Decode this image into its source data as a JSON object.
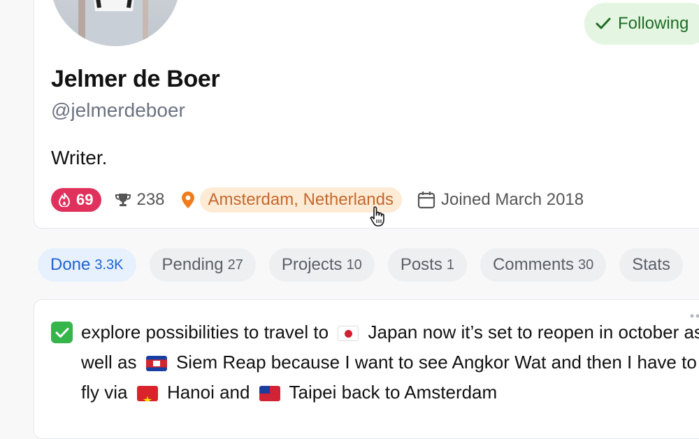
{
  "profile": {
    "name": "Jelmer de Boer",
    "handle": "@jelmerdeboer",
    "bio": "Writer.",
    "follow_label": "Following",
    "streak": "69",
    "praise": "238",
    "location": "Amsterdam, Netherlands",
    "joined": "Joined March 2018"
  },
  "tabs": [
    {
      "label": "Done",
      "count": "3.3K",
      "active": true
    },
    {
      "label": "Pending",
      "count": "27",
      "active": false
    },
    {
      "label": "Projects",
      "count": "10",
      "active": false
    },
    {
      "label": "Posts",
      "count": "1",
      "active": false
    },
    {
      "label": "Comments",
      "count": "30",
      "active": false
    },
    {
      "label": "Stats",
      "count": "",
      "active": false
    }
  ],
  "task": {
    "segments": [
      "explore possibilities to travel to",
      "Japan now it’s set to reopen in october as well as",
      "Siem Reap because I want to see Angkor Wat and then I have to fly via",
      "Hanoi and",
      "Taipei back to Amsterdam"
    ],
    "done": true
  },
  "colors": {
    "following_bg": "#e4f5e2",
    "following_text": "#1f6d24",
    "streak_bg": "#e0315d",
    "location_bg": "#fdebd6",
    "location_text": "#c2692d",
    "active_tab_bg": "#e7f1fd",
    "active_tab_text": "#1e63d0",
    "check_green": "#35b54a"
  },
  "icons": {
    "follow": "checkmark-icon",
    "streak": "flame-icon",
    "praise": "trophy-icon",
    "location": "map-pin-icon",
    "joined": "calendar-icon",
    "task_done": "checkbox-checked-icon",
    "more": "more-dots-icon",
    "flags": [
      "japan-flag-icon",
      "cambodia-flag-icon",
      "vietnam-flag-icon",
      "taiwan-flag-icon"
    ]
  }
}
